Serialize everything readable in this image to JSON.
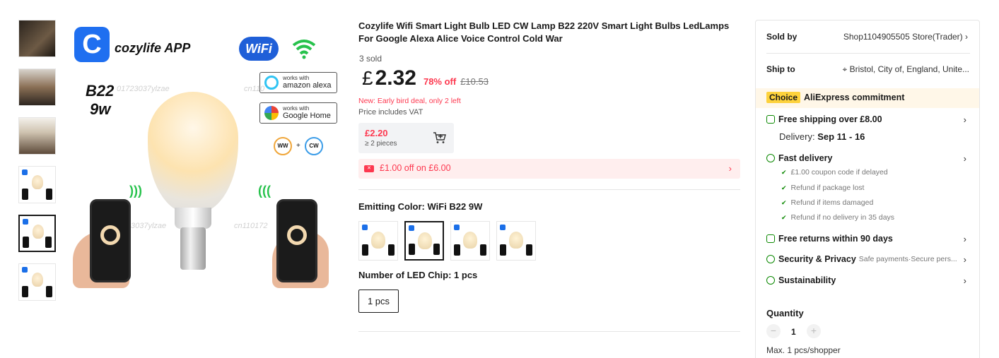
{
  "product": {
    "title": "Cozylife Wifi Smart Light Bulb LED CW Lamp B22 220V Smart Light Bulbs LedLamps For Google Alexa Alice Voice Control Cold War",
    "sold": "3 sold",
    "currency": "£",
    "price": "2.32",
    "discount": "78% off",
    "original_price": "£10.53",
    "deal_text": "New:  Early bird deal, only 2 left",
    "vat_text": "Price includes VAT",
    "tier_price": "£2.20",
    "tier_qty": "≥ 2 pieces",
    "coupon_text": "£1.00 off on £6.00",
    "color_label": "Emitting Color: WiFi B22 9W",
    "chip_label": "Number of LED Chip: 1 pcs",
    "chip_option": "1 pcs"
  },
  "image": {
    "app_name": "cozylife APP",
    "model": "B22",
    "wattage": "9w",
    "wifi_badge": "WiFi",
    "alexa_small": "works with",
    "alexa_big": "amazon alexa",
    "google_small": "works with",
    "google_big": "Google Home",
    "ww": "WW",
    "cw": "CW",
    "plus": "+",
    "watermark1": "01723037ylzae",
    "watermark2": "cn110",
    "watermark3": "3037ylzae",
    "watermark4": "cn110172"
  },
  "panel": {
    "sold_by_label": "Sold by",
    "sold_by_value": "Shop1104905505 Store(Trader)",
    "ship_to_label": "Ship to",
    "ship_to_value": "Bristol, City of, England, Unite...",
    "choice_badge": "Choice",
    "choice_text": "AliExpress commitment",
    "free_shipping": "Free shipping over £8.00",
    "delivery_label": "Delivery:",
    "delivery_date": "Sep 11 - 16",
    "fast_delivery": "Fast delivery",
    "checks": [
      "£1.00 coupon code if delayed",
      "Refund if package lost",
      "Refund if items damaged",
      "Refund if no delivery in 35 days"
    ],
    "free_returns": "Free returns within 90 days",
    "security": "Security & Privacy",
    "security_sub": "Safe payments·Secure pers...",
    "sustainability": "Sustainability",
    "quantity_label": "Quantity",
    "quantity_value": "1",
    "max_text": "Max. 1 pcs/shopper"
  },
  "icons": {
    "chevron": "›",
    "minus": "−",
    "plus": "+",
    "check": "✔",
    "pin": "⌖"
  },
  "colors": {
    "accent_red": "#fd384f",
    "choice_yellow": "#fdd23c",
    "check_green": "#0a8800",
    "brand_blue": "#1f6ff0"
  }
}
